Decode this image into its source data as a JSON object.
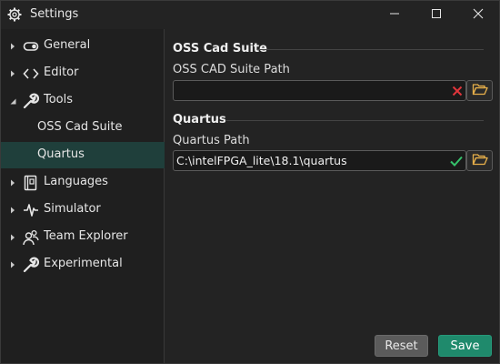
{
  "window": {
    "title": "Settings",
    "accent_color": "#1f3f3b",
    "controls": [
      "minimize-icon",
      "maximize-icon",
      "close-icon"
    ]
  },
  "sidebar": {
    "items": [
      {
        "label": "General",
        "icon": "toggle-icon",
        "expandable": true,
        "expanded": false
      },
      {
        "label": "Editor",
        "icon": "code-brackets-icon",
        "expandable": true,
        "expanded": false
      },
      {
        "label": "Tools",
        "icon": "wrench-icon",
        "expandable": true,
        "expanded": true
      },
      {
        "label": "OSS Cad Suite",
        "sub": true
      },
      {
        "label": "Quartus",
        "sub": true,
        "selected": true
      },
      {
        "label": "Languages",
        "icon": "book-icon",
        "expandable": true,
        "expanded": false
      },
      {
        "label": "Simulator",
        "icon": "waveform-icon",
        "expandable": true,
        "expanded": false
      },
      {
        "label": "Team Explorer",
        "icon": "team-icon",
        "expandable": true,
        "expanded": false
      },
      {
        "label": "Experimental",
        "icon": "wrench-icon",
        "expandable": true,
        "expanded": false
      }
    ]
  },
  "content": {
    "oss": {
      "title": "OSS Cad Suite",
      "path_label": "OSS CAD Suite Path",
      "path_value": "",
      "status": "invalid",
      "status_color": "#e0353b"
    },
    "quartus": {
      "title": "Quartus",
      "path_label": "Quartus Path",
      "path_value": "C:\\intelFPGA_lite\\18.1\\quartus",
      "status": "valid",
      "status_color": "#35c26b"
    }
  },
  "footer": {
    "reset_label": "Reset",
    "save_label": "Save",
    "save_color": "#1f8a6c"
  }
}
